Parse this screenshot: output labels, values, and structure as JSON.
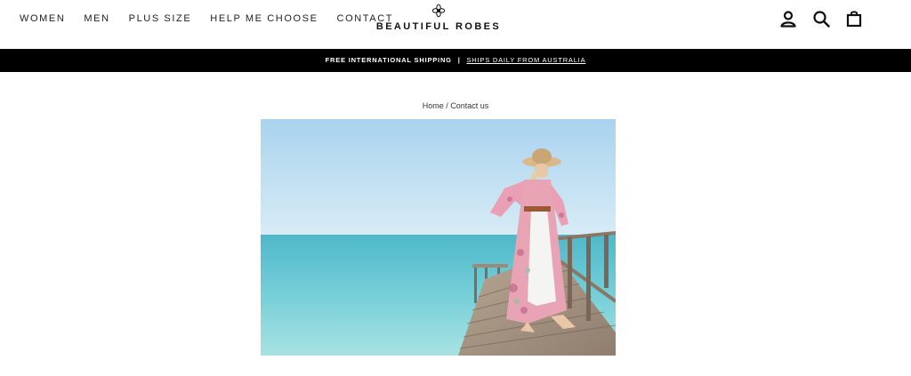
{
  "nav": {
    "items": [
      {
        "label": "WOMEN"
      },
      {
        "label": "MEN"
      },
      {
        "label": "PLUS SIZE"
      },
      {
        "label": "HELP ME CHOOSE"
      },
      {
        "label": "CONTACT"
      }
    ]
  },
  "logo": {
    "text": "BEAUTIFUL ROBES",
    "icon": "flower-logo-icon"
  },
  "header_icons": [
    "account-icon",
    "search-icon",
    "cart-bag-icon"
  ],
  "banner": {
    "text": "FREE INTERNATIONAL SHIPPING",
    "separator": "|",
    "link": "SHIPS DAILY FROM AUSTRALIA"
  },
  "breadcrumb": {
    "home": "Home",
    "separator": "/",
    "current": "Contact us"
  },
  "colors": {
    "banner_bg": "#000000",
    "sky": "#bfe0f2",
    "sea": "#6cc9d3",
    "robe": "#e8a3b4"
  }
}
